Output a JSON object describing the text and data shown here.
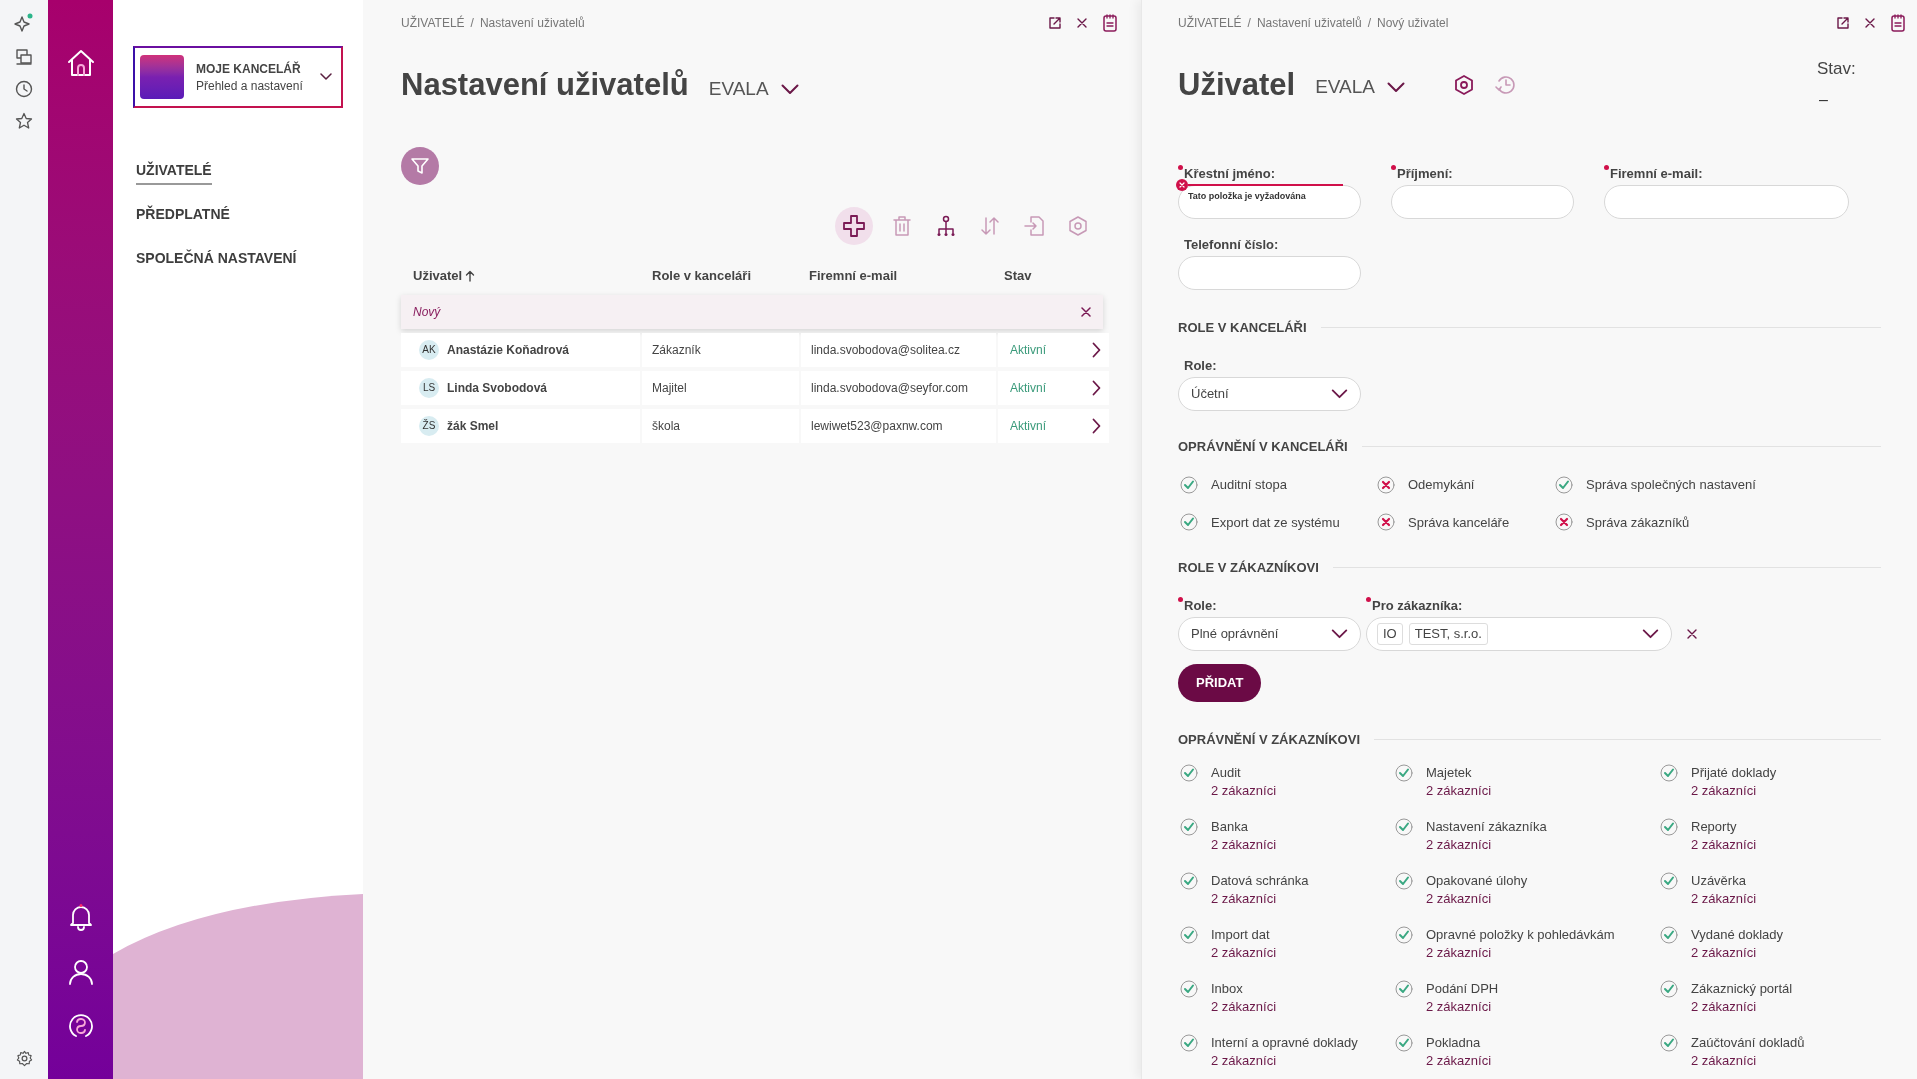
{
  "office_switcher": {
    "title": "MOJE KANCELÁŘ",
    "subtitle": "Přehled a nastavení"
  },
  "sidebar": {
    "items": [
      {
        "label": "UŽIVATELÉ",
        "selected": true
      },
      {
        "label": "PŘEDPLATNÉ",
        "selected": false
      },
      {
        "label": "SPOLEČNÁ NASTAVENÍ",
        "selected": false
      }
    ]
  },
  "list_panel": {
    "breadcrumb_separator": "/",
    "breadcrumb": [
      "UŽIVATELÉ",
      "Nastavení uživatelů"
    ],
    "title": "Nastavení uživatelů",
    "company": "EVALA",
    "table": {
      "columns": [
        {
          "label": "Uživatel",
          "sorted": true
        },
        {
          "label": "Role v kanceláři",
          "sorted": false
        },
        {
          "label": "Firemní e-mail",
          "sorted": false
        },
        {
          "label": "Stav",
          "sorted": false
        }
      ],
      "new_row": "Nový",
      "rows": [
        {
          "initials": "AK",
          "name": "Anastázie Koňadrová",
          "role": "Zákazník",
          "email": "linda.svobodova@solitea.cz",
          "status": "Aktivní"
        },
        {
          "initials": "LS",
          "name": "Linda Svobodová",
          "role": "Majitel",
          "email": "linda.svobodova@seyfor.com",
          "status": "Aktivní"
        },
        {
          "initials": "ŽS",
          "name": "žák Smel",
          "role": "škola",
          "email": "lewiwet523@paxnw.com",
          "status": "Aktivní"
        }
      ]
    }
  },
  "detail_panel": {
    "breadcrumb_separator": "/",
    "breadcrumb": [
      "UŽIVATELÉ",
      "Nastavení uživatelů",
      "Nový uživatel"
    ],
    "title": "Uživatel",
    "company": "EVALA",
    "status_label": "Stav:",
    "status_value": "–",
    "fields": [
      {
        "label": "Křestní jméno:",
        "required": true,
        "error": "Tato položka je vyžadována"
      },
      {
        "label": "Příjmení:",
        "required": true
      },
      {
        "label": "Firemní e-mail:",
        "required": true
      },
      {
        "label": "Telefonní číslo:",
        "required": false
      }
    ],
    "office_role": {
      "heading": "ROLE V KANCELÁŘI",
      "label": "Role:",
      "value": "Účetní"
    },
    "office_permissions": {
      "heading": "OPRÁVNĚNÍ V KANCELÁŘI",
      "items": [
        {
          "label": "Auditní stopa",
          "granted": true
        },
        {
          "label": "Odemykání",
          "granted": false
        },
        {
          "label": "Správa společných nastavení",
          "granted": true
        },
        {
          "label": "Export dat ze systému",
          "granted": true
        },
        {
          "label": "Správa kanceláře",
          "granted": false
        },
        {
          "label": "Správa zákazníků",
          "granted": false
        }
      ]
    },
    "customer_role": {
      "heading": "ROLE V ZÁKAZNÍKOVI",
      "role": {
        "label": "Role:",
        "required": true,
        "value": "Plné oprávnění"
      },
      "customer": {
        "label": "Pro zákazníka:",
        "required": true,
        "code": "IO",
        "name": "TEST, s.r.o."
      },
      "add_button": "PŘIDAT"
    },
    "customer_permissions": {
      "heading": "OPRÁVNĚNÍ V ZÁKAZNÍKOVI",
      "items": [
        {
          "label": "Audit",
          "granted": true,
          "scope": "2 zákazníci"
        },
        {
          "label": "Majetek",
          "granted": true,
          "scope": "2 zákazníci"
        },
        {
          "label": "Přijaté doklady",
          "granted": true,
          "scope": "2 zákazníci"
        },
        {
          "label": "Banka",
          "granted": true,
          "scope": "2 zákazníci"
        },
        {
          "label": "Nastavení zákazníka",
          "granted": true,
          "scope": "2 zákazníci"
        },
        {
          "label": "Reporty",
          "granted": true,
          "scope": "2 zákazníci"
        },
        {
          "label": "Datová schránka",
          "granted": true,
          "scope": "2 zákazníci"
        },
        {
          "label": "Opakované úlohy",
          "granted": true,
          "scope": "2 zákazníci"
        },
        {
          "label": "Uzávěrka",
          "granted": true,
          "scope": "2 zákazníci"
        },
        {
          "label": "Import dat",
          "granted": true,
          "scope": "2 zákazníci"
        },
        {
          "label": "Opravné položky k pohledávkám",
          "granted": true,
          "scope": "2 zákazníci"
        },
        {
          "label": "Vydané doklady",
          "granted": true,
          "scope": "2 zákazníci"
        },
        {
          "label": "Inbox",
          "granted": true,
          "scope": "2 zákazníci"
        },
        {
          "label": "Podání DPH",
          "granted": true,
          "scope": "2 zákazníci"
        },
        {
          "label": "Zákaznický portál",
          "granted": true,
          "scope": "2 zákazníci"
        },
        {
          "label": "Interní a opravné doklady",
          "granted": true,
          "scope": "2 zákazníci"
        },
        {
          "label": "Pokladna",
          "granted": true,
          "scope": "2 zákazníci"
        },
        {
          "label": "Zaúčtování dokladů",
          "granted": true,
          "scope": "2 zákazníci"
        }
      ]
    }
  }
}
